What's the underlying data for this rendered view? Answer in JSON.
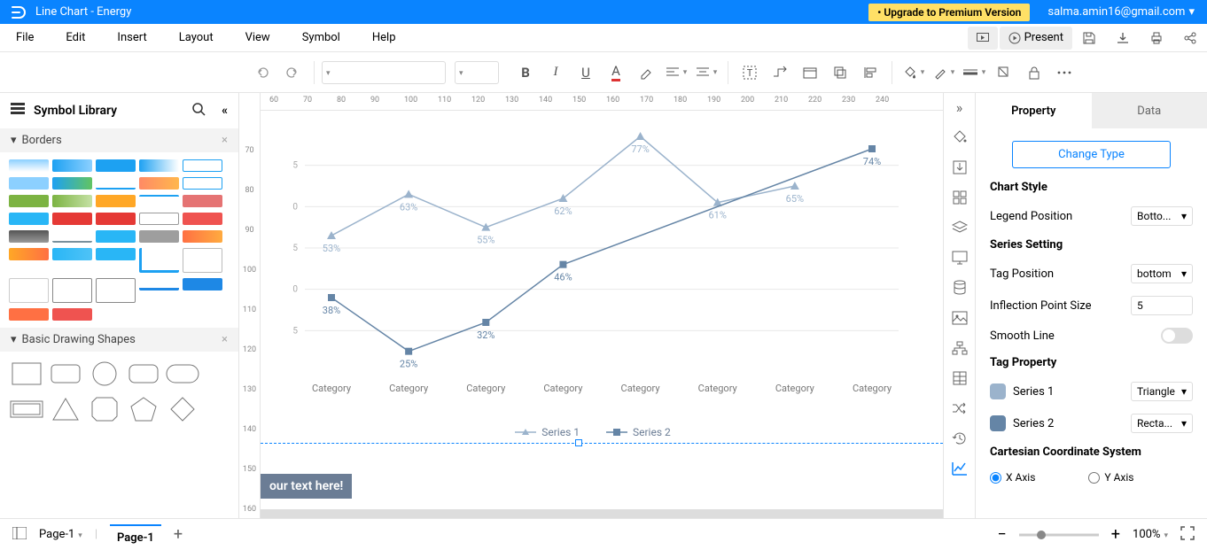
{
  "topbar": {
    "title": "Line Chart - Energy",
    "upgrade": "• Upgrade to Premium Version",
    "user": "salma.amin16@gmail.com"
  },
  "menu": [
    "File",
    "Edit",
    "Insert",
    "Layout",
    "View",
    "Symbol",
    "Help"
  ],
  "present_label": "Present",
  "sidebar": {
    "title": "Symbol Library",
    "section_borders": "Borders",
    "section_shapes": "Basic Drawing Shapes"
  },
  "hruler_ticks": [
    60,
    70,
    80,
    90,
    100,
    110,
    120,
    130,
    140,
    150,
    160,
    170,
    180,
    190,
    200,
    210,
    220,
    230,
    240
  ],
  "vruler_ticks": [
    70,
    80,
    90,
    100,
    110,
    120,
    130,
    140,
    150,
    160
  ],
  "yaxis_ticks": [
    "5",
    "0",
    "5",
    "0",
    "5"
  ],
  "chart_data": {
    "type": "line",
    "title": "",
    "xlabel": "",
    "ylabel": "",
    "categories": [
      "Category",
      "Category",
      "Category",
      "Category",
      "Category",
      "Category",
      "Category",
      "Category"
    ],
    "series": [
      {
        "name": "Series 1",
        "values": [
          53,
          63,
          55,
          62,
          77,
          61,
          65,
          null
        ],
        "labels": [
          "53%",
          "63%",
          "55%",
          "62%",
          "77%",
          "61%",
          "65%",
          ""
        ],
        "marker": "triangle",
        "color": "#9bb3cc"
      },
      {
        "name": "Series 2",
        "values": [
          38,
          25,
          32,
          46,
          null,
          null,
          null,
          74
        ],
        "labels": [
          "38%",
          "25%",
          "32%",
          "46%",
          "",
          "",
          "",
          "74%"
        ],
        "marker": "square",
        "color": "#6585a6"
      }
    ],
    "legend_position": "bottom"
  },
  "placeholder_text": "our text here!",
  "prop": {
    "tab_property": "Property",
    "tab_data": "Data",
    "change_type": "Change Type",
    "chart_style": "Chart Style",
    "legend_position_label": "Legend Position",
    "legend_position_value": "Botto...",
    "series_setting": "Series Setting",
    "tag_position_label": "Tag Position",
    "tag_position_value": "bottom",
    "inflection_label": "Inflection Point Size",
    "inflection_value": "5",
    "smooth_label": "Smooth Line",
    "tag_property": "Tag Property",
    "series1_label": "Series 1",
    "series1_shape": "Triangle",
    "series1_color": "#9bb3cc",
    "series2_label": "Series 2",
    "series2_shape": "Recta...",
    "series2_color": "#6585a6",
    "cartesian": "Cartesian Coordinate System",
    "xaxis": "X Axis",
    "yaxis": "Y Axis"
  },
  "bottom": {
    "page_sel": "Page-1",
    "page_tab": "Page-1",
    "zoom": "100%"
  }
}
